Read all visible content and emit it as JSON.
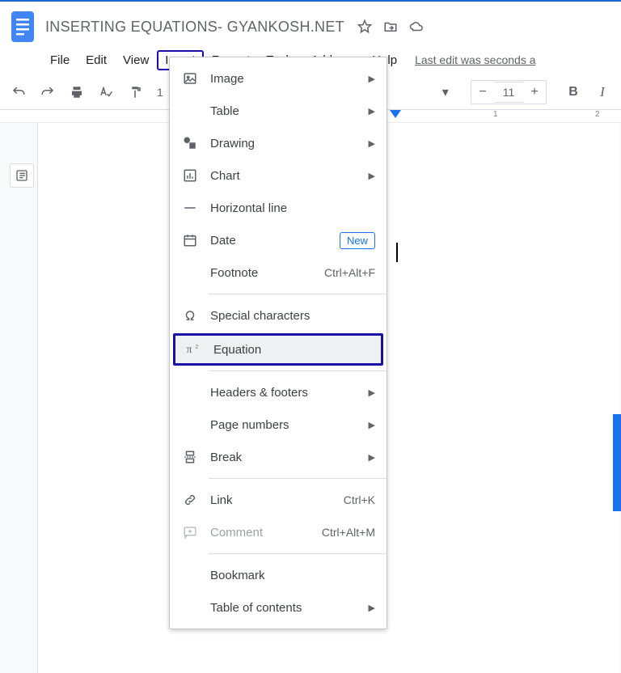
{
  "document": {
    "title": "INSERTING EQUATIONS- GYANKOSH.NET"
  },
  "menubar": {
    "file": "File",
    "edit": "Edit",
    "view": "View",
    "insert": "Insert",
    "format": "Format",
    "tools": "Tools",
    "addons": "Add-ons",
    "help": "Help",
    "last_edit": "Last edit was seconds a"
  },
  "toolbar": {
    "font_size": "11",
    "zoom_hint": "1"
  },
  "ruler": {
    "mark1": "1",
    "mark2": "2"
  },
  "insert_menu": {
    "image": "Image",
    "table": "Table",
    "drawing": "Drawing",
    "chart": "Chart",
    "horizontal_line": "Horizontal line",
    "date": "Date",
    "date_badge": "New",
    "footnote": "Footnote",
    "footnote_shortcut": "Ctrl+Alt+F",
    "special_characters": "Special characters",
    "equation": "Equation",
    "headers_footers": "Headers & footers",
    "page_numbers": "Page numbers",
    "break": "Break",
    "link": "Link",
    "link_shortcut": "Ctrl+K",
    "comment": "Comment",
    "comment_shortcut": "Ctrl+Alt+M",
    "bookmark": "Bookmark",
    "table_of_contents": "Table of contents"
  }
}
